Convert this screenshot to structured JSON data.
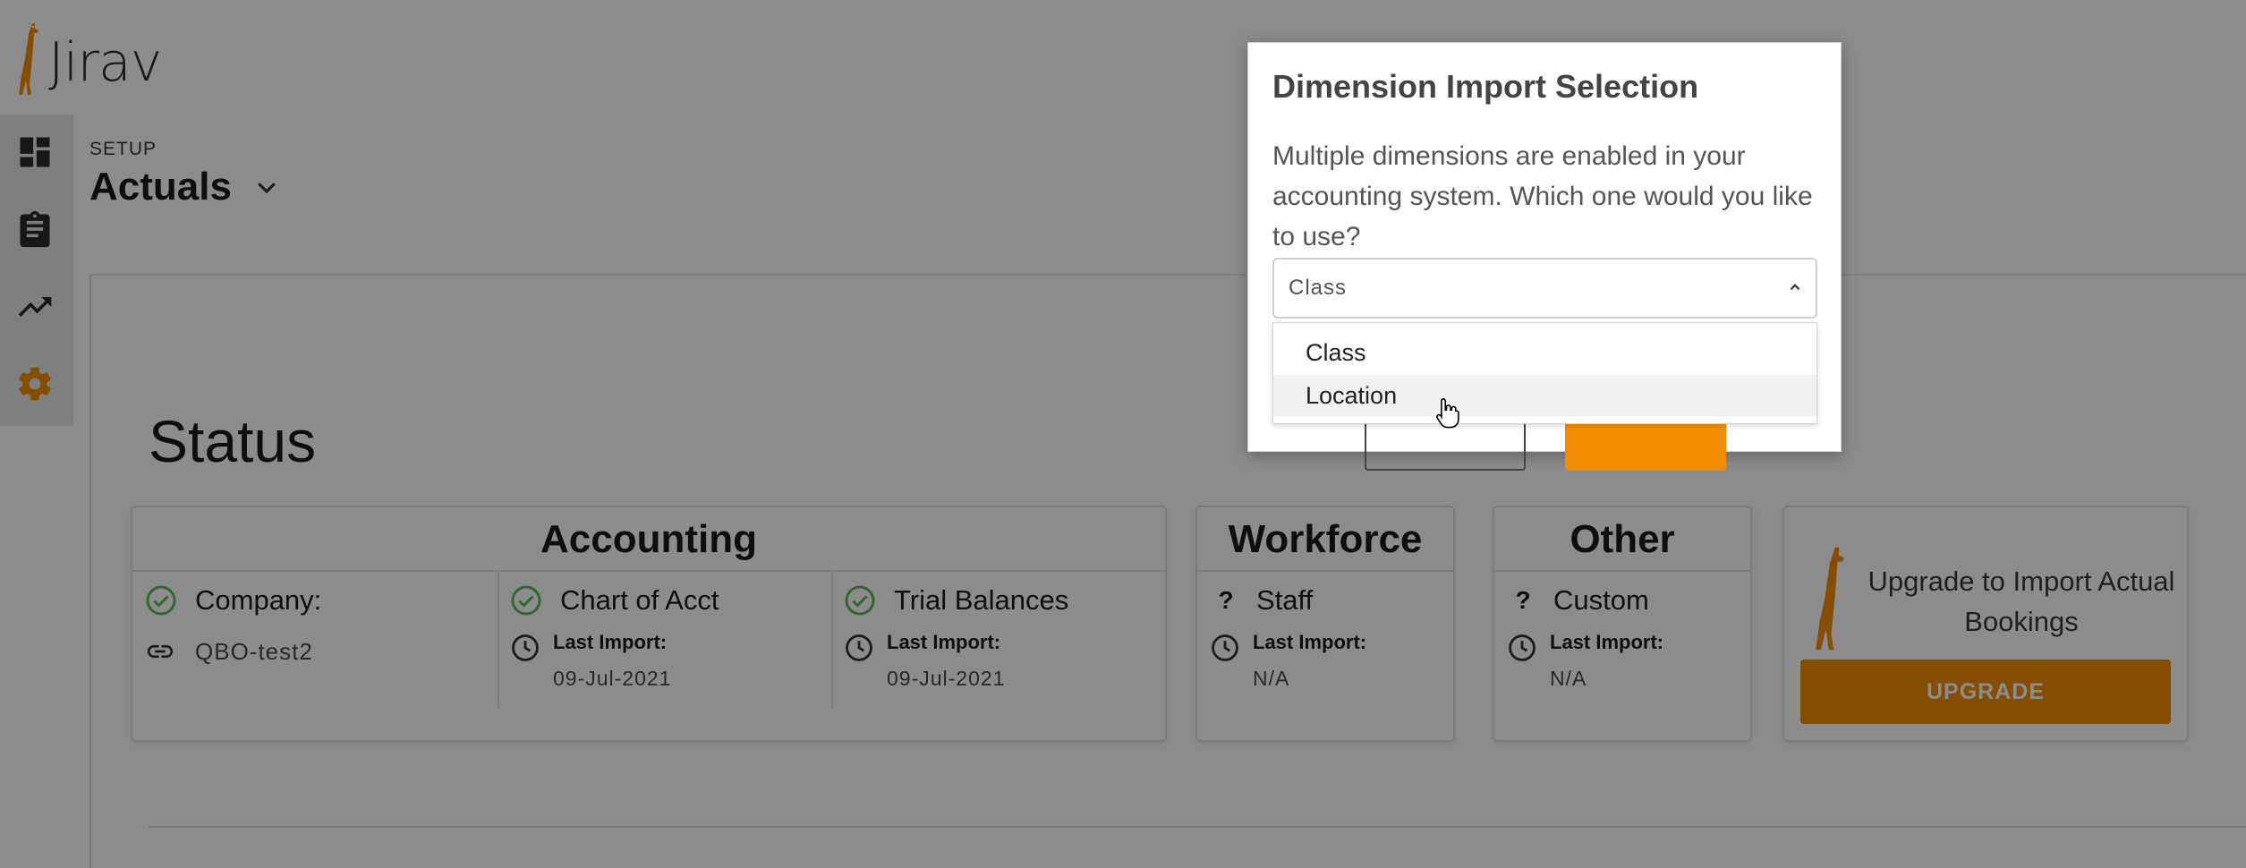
{
  "app": {
    "brand_name": "Jirav",
    "brand_color": "#f28c00"
  },
  "sidebar": {
    "items": [
      {
        "icon": "dashboard-icon"
      },
      {
        "icon": "clipboard-icon"
      },
      {
        "icon": "trending-icon"
      },
      {
        "icon": "gear-icon",
        "active": true
      }
    ]
  },
  "header": {
    "breadcrumb": "SETUP",
    "title": "Actuals",
    "title_icon": "chevron-down-icon"
  },
  "status": {
    "heading": "Status",
    "cards": {
      "accounting": {
        "title": "Accounting",
        "company": {
          "label": "Company:",
          "value": "QBO-test2"
        },
        "chart_of_acct": {
          "label": "Chart of Acct",
          "last_import_label": "Last Import:",
          "last_import_value": "09-Jul-2021"
        },
        "trial_balances": {
          "label": "Trial Balances",
          "last_import_label": "Last Import:",
          "last_import_value": "09-Jul-2021"
        }
      },
      "workforce": {
        "title": "Workforce",
        "item": {
          "label": "Staff",
          "last_import_label": "Last Import:",
          "last_import_value": "N/A"
        }
      },
      "other": {
        "title": "Other",
        "item": {
          "label": "Custom",
          "last_import_label": "Last Import:",
          "last_import_value": "N/A"
        }
      },
      "upgrade": {
        "text": "Upgrade to Import Actual Bookings",
        "button_label": "UPGRADE"
      }
    }
  },
  "modal": {
    "title": "Dimension Import Selection",
    "body": "Multiple dimensions are enabled in your accounting system. Which one would you like to use?",
    "select": {
      "value": "Class",
      "options": [
        "Class",
        "Location"
      ],
      "hovered_option": "Location"
    }
  }
}
